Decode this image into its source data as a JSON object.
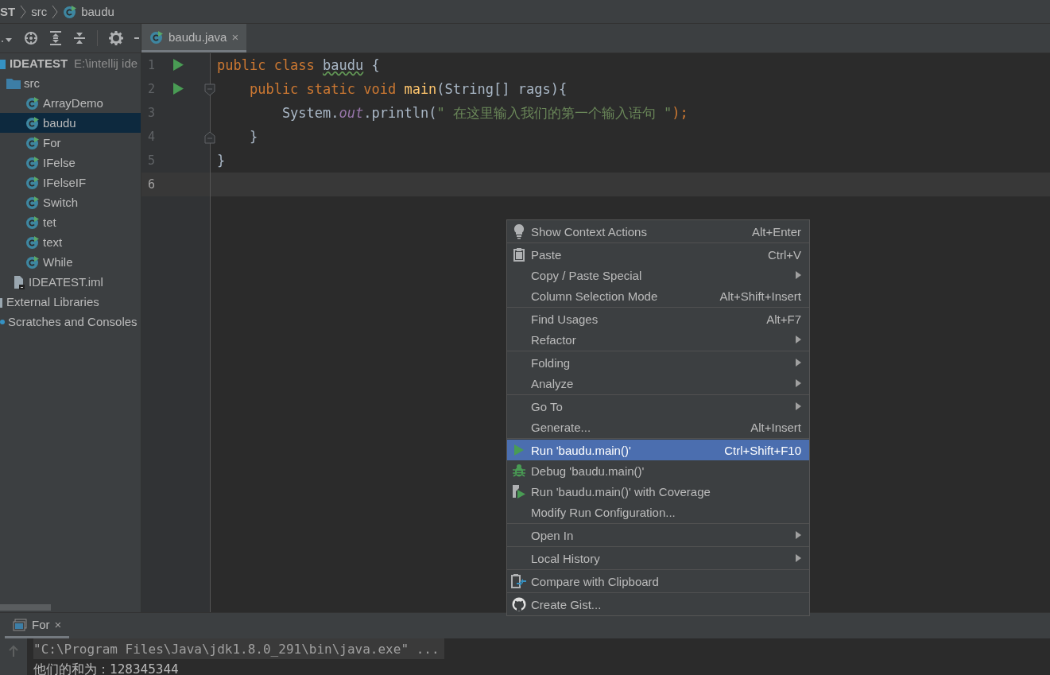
{
  "breadcrumb": [
    {
      "label": "ST"
    },
    {
      "label": "src"
    },
    {
      "label": "baudu"
    }
  ],
  "project_tree": [
    {
      "kind": "module",
      "label": "IDEATEST",
      "path": "E:\\intellij ide",
      "selected": false,
      "children": [
        {
          "kind": "folder",
          "label": "src",
          "selected": false,
          "children": [
            {
              "kind": "class",
              "label": "ArrayDemo",
              "selected": false
            },
            {
              "kind": "class",
              "label": "baudu",
              "selected": true
            },
            {
              "kind": "class",
              "label": "For",
              "selected": false
            },
            {
              "kind": "class",
              "label": "IFelse",
              "selected": false
            },
            {
              "kind": "class",
              "label": "IFelseIF",
              "selected": false
            },
            {
              "kind": "class",
              "label": "Switch",
              "selected": false
            },
            {
              "kind": "class",
              "label": "tet",
              "selected": false
            },
            {
              "kind": "class",
              "label": "text",
              "selected": false
            },
            {
              "kind": "class",
              "label": "While",
              "selected": false
            }
          ]
        },
        {
          "kind": "file",
          "label": "IDEATEST.iml",
          "selected": false
        }
      ]
    },
    {
      "kind": "library",
      "label": "External Libraries",
      "selected": false
    },
    {
      "kind": "scratches",
      "label": "Scratches and Consoles",
      "selected": false
    }
  ],
  "editor_tabs": [
    {
      "label": "baudu.java",
      "close": "×",
      "selected": true
    }
  ],
  "code_lines": [
    {
      "number": "1",
      "run": true,
      "fold_start": false,
      "fold_end": false,
      "current": false,
      "tokens": [
        {
          "text": "public class ",
          "kind": "keyword"
        },
        {
          "text": "baudu",
          "kind": "warning"
        },
        {
          "text": " {",
          "kind": "plain"
        }
      ]
    },
    {
      "number": "2",
      "run": true,
      "fold_start": true,
      "fold_end": false,
      "current": false,
      "tokens": [
        {
          "text": "    public static void ",
          "kind": "keyword"
        },
        {
          "text": "main",
          "kind": "method"
        },
        {
          "text": "(String[] rags){",
          "kind": "plain"
        }
      ]
    },
    {
      "number": "3",
      "run": false,
      "fold_start": false,
      "fold_end": false,
      "current": false,
      "tokens": [
        {
          "text": "        System.",
          "kind": "plain"
        },
        {
          "text": "out",
          "kind": "field"
        },
        {
          "text": ".println(",
          "kind": "plain"
        },
        {
          "text": "\" 在这里输入我们的第一个输入语句 \"",
          "kind": "string"
        },
        {
          "text": ");",
          "kind": "keyword"
        }
      ]
    },
    {
      "number": "4",
      "run": false,
      "fold_start": false,
      "fold_end": true,
      "current": false,
      "tokens": [
        {
          "text": "    }",
          "kind": "plain"
        }
      ]
    },
    {
      "number": "5",
      "run": false,
      "fold_start": false,
      "fold_end": false,
      "current": false,
      "tokens": [
        {
          "text": "}",
          "kind": "plain"
        }
      ]
    },
    {
      "number": "6",
      "run": false,
      "fold_start": false,
      "fold_end": false,
      "current": true
    }
  ],
  "context_menu": [
    [
      {
        "label": "Show Context Actions",
        "shortcut": "Alt+Enter",
        "submenu": false,
        "selected": false
      }
    ],
    [
      {
        "label": "Paste",
        "shortcut": "Ctrl+V",
        "submenu": false,
        "selected": false
      },
      {
        "label": "Copy / Paste Special",
        "submenu": true,
        "selected": false
      },
      {
        "label": "Column Selection Mode",
        "shortcut": "Alt+Shift+Insert",
        "submenu": false,
        "selected": false
      }
    ],
    [
      {
        "label": "Find Usages",
        "shortcut": "Alt+F7",
        "submenu": false,
        "selected": false
      },
      {
        "label": "Refactor",
        "submenu": true,
        "selected": false
      }
    ],
    [
      {
        "label": "Folding",
        "submenu": true,
        "selected": false
      },
      {
        "label": "Analyze",
        "submenu": true,
        "selected": false
      }
    ],
    [
      {
        "label": "Go To",
        "submenu": true,
        "selected": false
      },
      {
        "label": "Generate...",
        "shortcut": "Alt+Insert",
        "submenu": false,
        "selected": false
      }
    ],
    [
      {
        "label": "Run 'baudu.main()'",
        "shortcut": "Ctrl+Shift+F10",
        "submenu": false,
        "selected": true
      },
      {
        "label": "Debug 'baudu.main()'",
        "submenu": false,
        "selected": false
      },
      {
        "label": "Run 'baudu.main()' with Coverage",
        "submenu": false,
        "selected": false
      },
      {
        "label": "Modify Run Configuration...",
        "submenu": false,
        "selected": false
      }
    ],
    [
      {
        "label": "Open In",
        "submenu": true,
        "selected": false
      }
    ],
    [
      {
        "label": "Local History",
        "submenu": true,
        "selected": false
      }
    ],
    [
      {
        "label": "Compare with Clipboard",
        "submenu": false,
        "selected": false
      }
    ],
    [
      {
        "label": "Create Gist...",
        "submenu": false,
        "selected": false
      }
    ]
  ],
  "run_panel": {
    "tab": {
      "label": "For",
      "close": "×",
      "selected": true
    },
    "console": [
      {
        "text": "\"C:\\Program Files\\Java\\jdk1.8.0_291\\bin\\java.exe\" ...",
        "highlighted": true
      },
      {
        "text": "他们的和为：128345344",
        "highlighted": false
      }
    ]
  }
}
